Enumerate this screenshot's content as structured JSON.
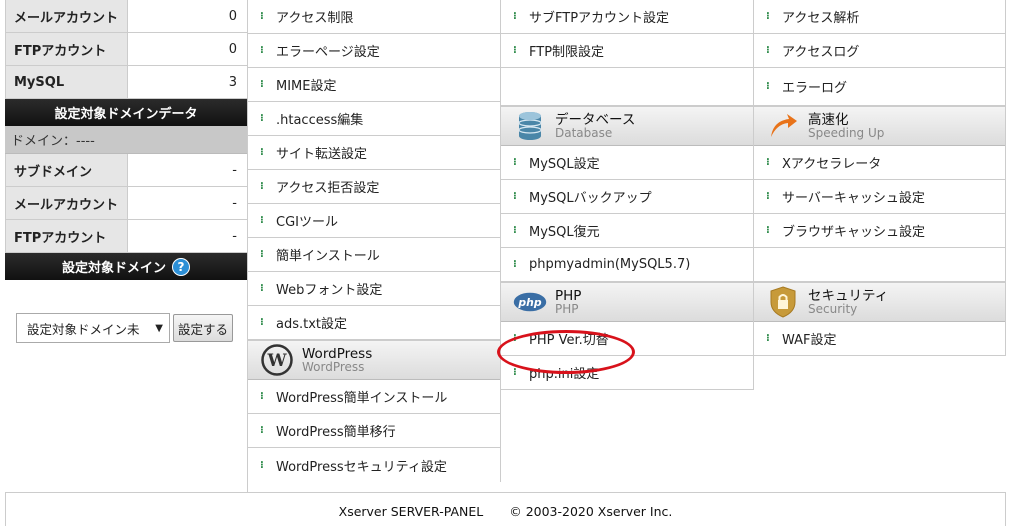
{
  "sidebar": {
    "top_stats": [
      {
        "label": "メールアカウント",
        "value": "0"
      },
      {
        "label": "FTPアカウント",
        "value": "0"
      },
      {
        "label": "MySQL",
        "value": "3"
      }
    ],
    "domain_data_header": "設定対象ドメインデータ",
    "domain_line": "ドメイン：----",
    "domain_stats": [
      {
        "label": "サブドメイン",
        "value": "-"
      },
      {
        "label": "メールアカウント",
        "value": "-"
      },
      {
        "label": "FTPアカウント",
        "value": "-"
      }
    ],
    "target_domain_header": "設定対象ドメイン",
    "help_icon": "?",
    "select_value": "設定対象ドメイン未",
    "select_arrow": "▼",
    "set_button": "設定する"
  },
  "columns": {
    "col1": {
      "items": [
        "アクセス制限",
        "エラーページ設定",
        "MIME設定",
        ".htaccess編集",
        "サイト転送設定",
        "アクセス拒否設定",
        "CGIツール",
        "簡単インストール",
        "Webフォント設定",
        "ads.txt設定"
      ],
      "section": {
        "title": "WordPress",
        "sub": "WordPress",
        "icon": "wordpress-icon"
      },
      "section_items": [
        "WordPress簡単インストール",
        "WordPress簡単移行",
        "WordPressセキュリティ設定"
      ]
    },
    "col2": {
      "items": [
        "サブFTPアカウント設定",
        "FTP制限設定"
      ],
      "section1": {
        "title": "データベース",
        "sub": "Database",
        "icon": "database-icon"
      },
      "section1_items": [
        "MySQL設定",
        "MySQLバックアップ",
        "MySQL復元",
        "phpmyadmin(MySQL5.7)"
      ],
      "section2": {
        "title": "PHP",
        "sub": "PHP",
        "icon": "php-icon",
        "icon_text": "php"
      },
      "section2_items": [
        "PHP Ver.切替",
        "php.ini設定"
      ]
    },
    "col3": {
      "items": [
        "アクセス解析",
        "アクセスログ",
        "エラーログ"
      ],
      "section1": {
        "title": "高速化",
        "sub": "Speeding Up",
        "icon": "speed-arrow-icon"
      },
      "section1_items": [
        "Xアクセラレータ",
        "サーバーキャッシュ設定",
        "ブラウザキャッシュ設定"
      ],
      "section2": {
        "title": "セキュリティ",
        "sub": "Security",
        "icon": "lock-icon"
      },
      "section2_items": [
        "WAF設定"
      ]
    }
  },
  "footer": {
    "product": "Xserver SERVER-PANEL",
    "copyright": "© 2003-2020 Xserver Inc."
  },
  "colors": {
    "highlight": "#d8121b",
    "arrow": "#2e8b4a",
    "header_dark": "#111111"
  }
}
